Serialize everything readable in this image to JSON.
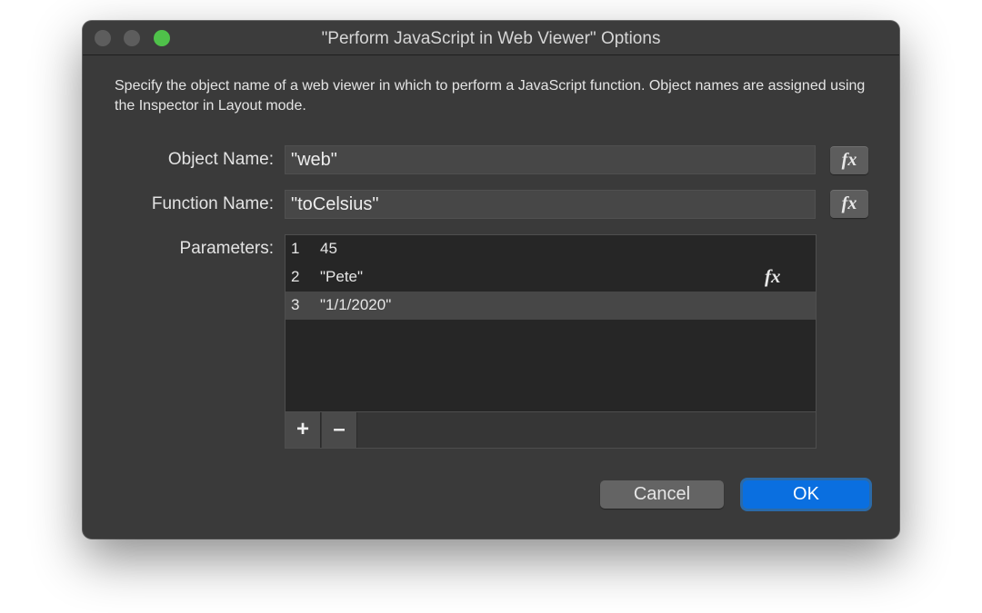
{
  "dialog": {
    "title": "\"Perform JavaScript in Web Viewer\" Options",
    "description": "Specify the object name of a web viewer in which to perform a JavaScript function. Object names are assigned using the Inspector in Layout mode."
  },
  "object_name": {
    "label": "Object Name:",
    "value": "\"web\""
  },
  "function_name": {
    "label": "Function Name:",
    "value": "\"toCelsius\""
  },
  "fx_label": "fx",
  "parameters": {
    "label": "Parameters:",
    "rows": [
      {
        "index": "1",
        "value": "45"
      },
      {
        "index": "2",
        "value": "\"Pete\""
      },
      {
        "index": "3",
        "value": "\"1/1/2020\""
      }
    ],
    "selected_index": "3",
    "add_label": "+",
    "remove_label": "–"
  },
  "buttons": {
    "cancel": "Cancel",
    "ok": "OK"
  },
  "colors": {
    "accent": "#0a6fe0",
    "window_bg": "#3a3a3a",
    "zoom_button": "#4fc14a"
  }
}
